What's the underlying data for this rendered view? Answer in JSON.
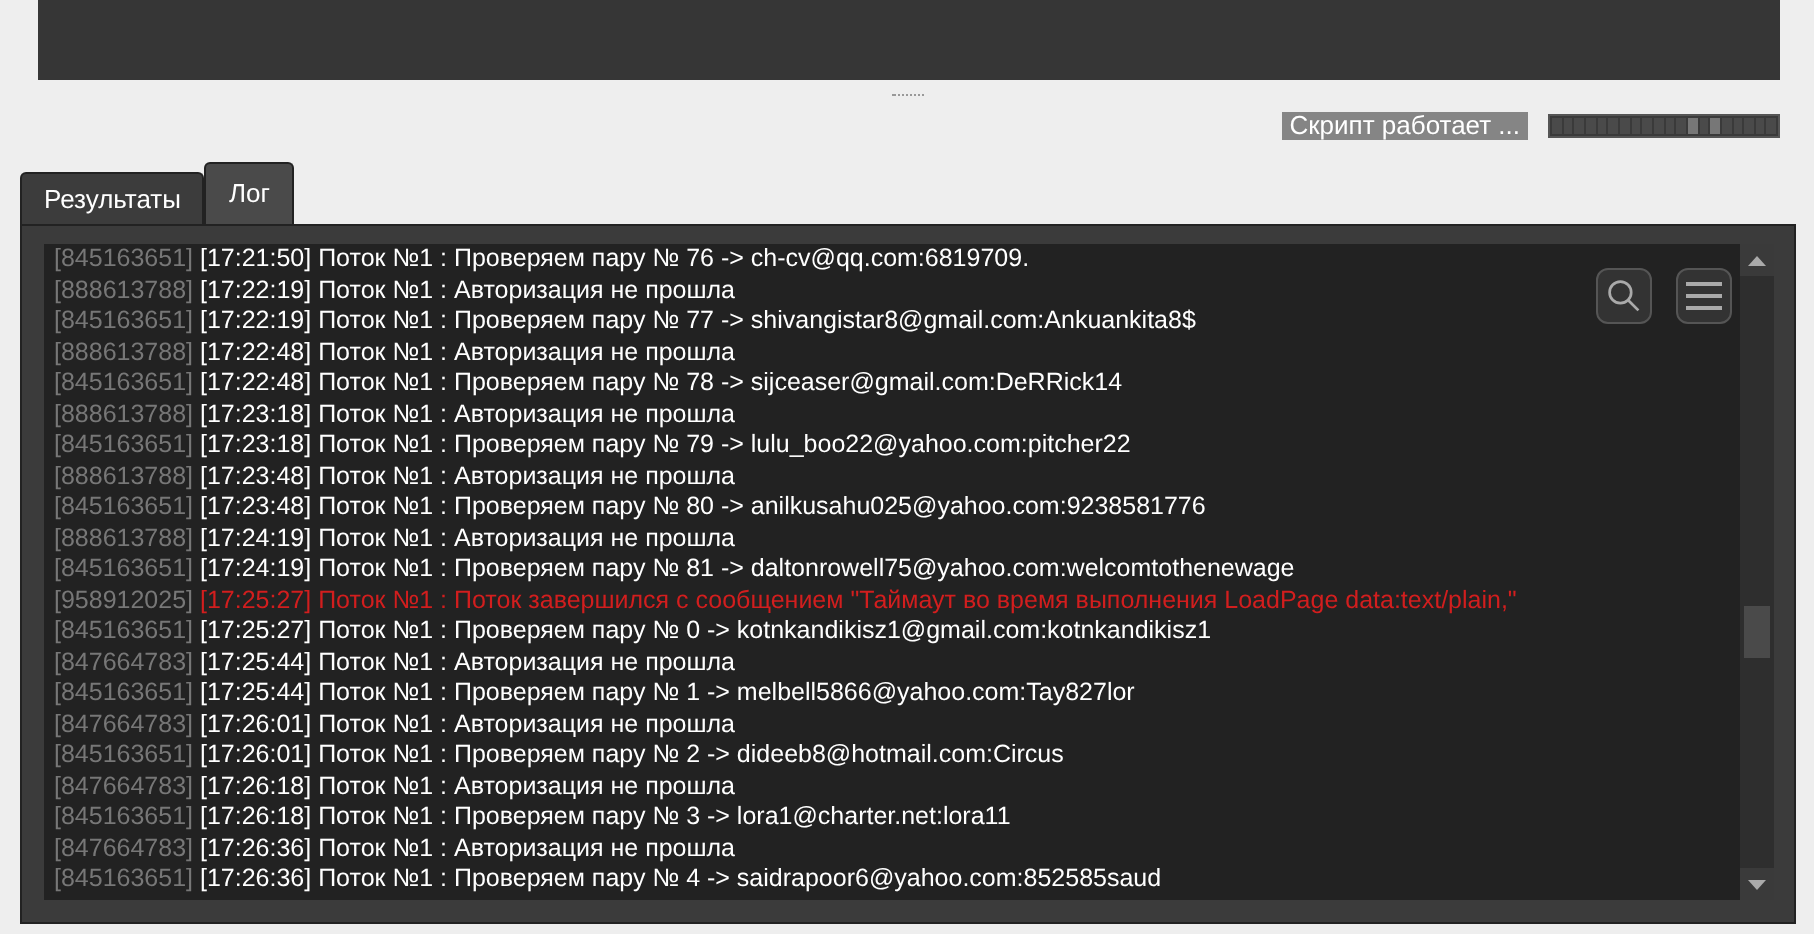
{
  "status": {
    "text": "Скрипт работает ..."
  },
  "tabs": [
    {
      "label": "Результаты",
      "selected": false
    },
    {
      "label": "Лог",
      "selected": true
    }
  ],
  "log": [
    {
      "kind": "info",
      "id": "[845163651]",
      "text": "[17:21:50] Поток №1 : Проверяем пару № 76 -> ch-cv@qq.com:6819709."
    },
    {
      "kind": "info",
      "id": "[888613788]",
      "text": "[17:22:19] Поток №1 : Авторизация не прошла"
    },
    {
      "kind": "info",
      "id": "[845163651]",
      "text": "[17:22:19] Поток №1 : Проверяем пару № 77 -> shivangistar8@gmail.com:Ankuankita8$"
    },
    {
      "kind": "info",
      "id": "[888613788]",
      "text": "[17:22:48] Поток №1 : Авторизация не прошла"
    },
    {
      "kind": "info",
      "id": "[845163651]",
      "text": "[17:22:48] Поток №1 : Проверяем пару № 78 -> sijceaser@gmail.com:DeRRick14"
    },
    {
      "kind": "info",
      "id": "[888613788]",
      "text": "[17:23:18] Поток №1 : Авторизация не прошла"
    },
    {
      "kind": "info",
      "id": "[845163651]",
      "text": "[17:23:18] Поток №1 : Проверяем пару № 79 -> lulu_boo22@yahoo.com:pitcher22"
    },
    {
      "kind": "info",
      "id": "[888613788]",
      "text": "[17:23:48] Поток №1 : Авторизация не прошла"
    },
    {
      "kind": "info",
      "id": "[845163651]",
      "text": "[17:23:48] Поток №1 : Проверяем пару № 80 -> anilkusahu025@yahoo.com:9238581776"
    },
    {
      "kind": "info",
      "id": "[888613788]",
      "text": "[17:24:19] Поток №1 : Авторизация не прошла"
    },
    {
      "kind": "info",
      "id": "[845163651]",
      "text": "[17:24:19] Поток №1 : Проверяем пару № 81 -> daltonrowell75@yahoo.com:welcomtothenewage"
    },
    {
      "kind": "error",
      "id": "[958912025]",
      "text": "[17:25:27] Поток №1 : Поток завершился с сообщением \"Таймаут во время выполнения LoadPage data:text/plain,\""
    },
    {
      "kind": "info",
      "id": "[845163651]",
      "text": "[17:25:27] Поток №1 : Проверяем пару № 0 -> kotnkandikisz1@gmail.com:kotnkandikisz1"
    },
    {
      "kind": "info",
      "id": "[847664783]",
      "text": "[17:25:44] Поток №1 : Авторизация не прошла"
    },
    {
      "kind": "info",
      "id": "[845163651]",
      "text": "[17:25:44] Поток №1 : Проверяем пару № 1 -> melbell5866@yahoo.com:Tay827lor"
    },
    {
      "kind": "info",
      "id": "[847664783]",
      "text": "[17:26:01] Поток №1 : Авторизация не прошла"
    },
    {
      "kind": "info",
      "id": "[845163651]",
      "text": "[17:26:01] Поток №1 : Проверяем пару № 2 -> dideeb8@hotmail.com:Circus"
    },
    {
      "kind": "info",
      "id": "[847664783]",
      "text": "[17:26:18] Поток №1 : Авторизация не прошла"
    },
    {
      "kind": "info",
      "id": "[845163651]",
      "text": "[17:26:18] Поток №1 : Проверяем пару № 3 -> lora1@charter.net:lora11"
    },
    {
      "kind": "info",
      "id": "[847664783]",
      "text": "[17:26:36] Поток №1 : Авторизация не прошла"
    },
    {
      "kind": "info",
      "id": "[845163651]",
      "text": "[17:26:36] Поток №1 : Проверяем пару № 4 -> saidrapoor6@yahoo.com:852585saud"
    }
  ]
}
